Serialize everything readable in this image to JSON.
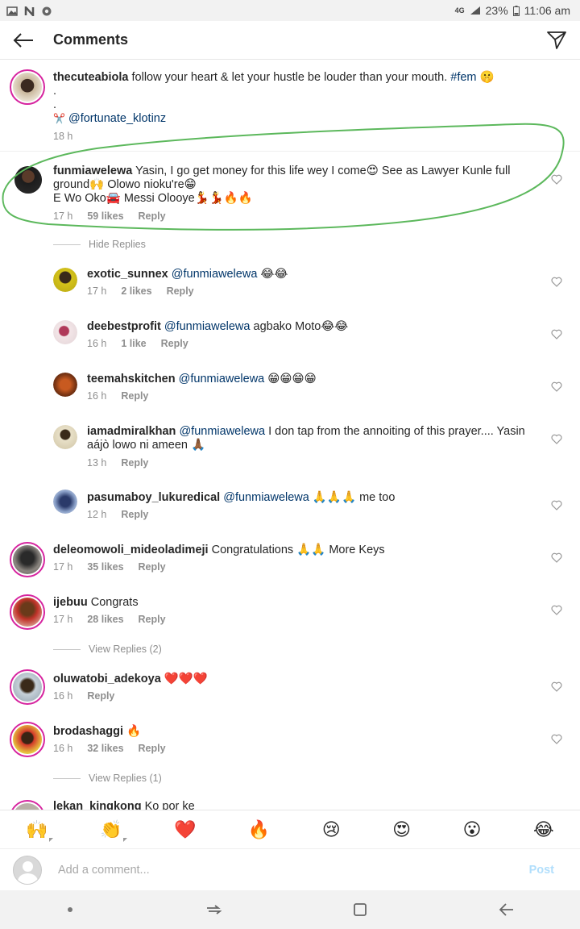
{
  "statusbar": {
    "network": "4G",
    "battery": "23%",
    "time": "11:06 am"
  },
  "header": {
    "title": "Comments"
  },
  "caption": {
    "username": "thecuteabiola",
    "text": "follow your heart & let your hustle be louder than your mouth.",
    "hashtag": "#fem",
    "emoji": "🤫",
    "dot1": ".",
    "dot2": ".",
    "scissors": "✂️",
    "credit": "@fortunate_klotinz",
    "time": "18 h"
  },
  "comments": [
    {
      "username": "funmiawelewa",
      "line1": "Yasin, I go get money for this life wey I come😍 See as Lawyer Kunle full",
      "line2": "ground🙌 Olowo nioku're😁",
      "line3": "E Wo Oko🚘 Messi Olooye💃💃🔥🔥",
      "time": "17 h",
      "likes": "59 likes",
      "reply": "Reply",
      "toggle": "Hide Replies"
    },
    {
      "username": "exotic_sunnex",
      "mention": "@funmiawelewa",
      "text": "😂😂",
      "time": "17 h",
      "likes": "2 likes",
      "reply": "Reply"
    },
    {
      "username": "deebestprofit",
      "mention": "@funmiawelewa",
      "text": "agbako Moto😂😂",
      "time": "16 h",
      "likes": "1 like",
      "reply": "Reply"
    },
    {
      "username": "teemahskitchen",
      "mention": "@funmiawelewa",
      "text": "😁😁😁😁",
      "time": "16 h",
      "reply": "Reply"
    },
    {
      "username": "iamadmiralkhan",
      "mention": "@funmiawelewa",
      "text": "I don tap from the annoiting of this prayer.... Yasin",
      "text2": "aájò lowo ni ameen 🙏🏾",
      "time": "13 h",
      "reply": "Reply"
    },
    {
      "username": "pasumaboy_lukuredical",
      "mention": "@funmiawelewa",
      "text": "🙏🙏🙏 me too",
      "time": "12 h",
      "reply": "Reply"
    },
    {
      "username": "deleomowoli_mideoladimeji",
      "text": "Congratulations 🙏🙏 More Keys",
      "time": "17 h",
      "likes": "35 likes",
      "reply": "Reply"
    },
    {
      "username": "ijebuu",
      "text": "Congrats",
      "time": "17 h",
      "likes": "28 likes",
      "reply": "Reply",
      "toggle": "View Replies (2)"
    },
    {
      "username": "oluwatobi_adekoya",
      "text": "❤️❤️❤️",
      "time": "16 h",
      "reply": "Reply"
    },
    {
      "username": "brodashaggi",
      "text": "🔥",
      "time": "16 h",
      "likes": "32 likes",
      "reply": "Reply",
      "toggle": "View Replies (1)"
    },
    {
      "username": "lekan_kingkong",
      "text": "Ko por ke"
    }
  ],
  "emoji_bar": [
    "🙌",
    "👏",
    "❤️",
    "🔥",
    "😢",
    "😍",
    "😮",
    "😂"
  ],
  "compose": {
    "placeholder": "Add a comment...",
    "post": "Post"
  },
  "colors": {
    "accent_ring": "#d6249f",
    "mention": "#003569",
    "meta": "#8e8e8e",
    "highlight": "#5cb85c"
  }
}
